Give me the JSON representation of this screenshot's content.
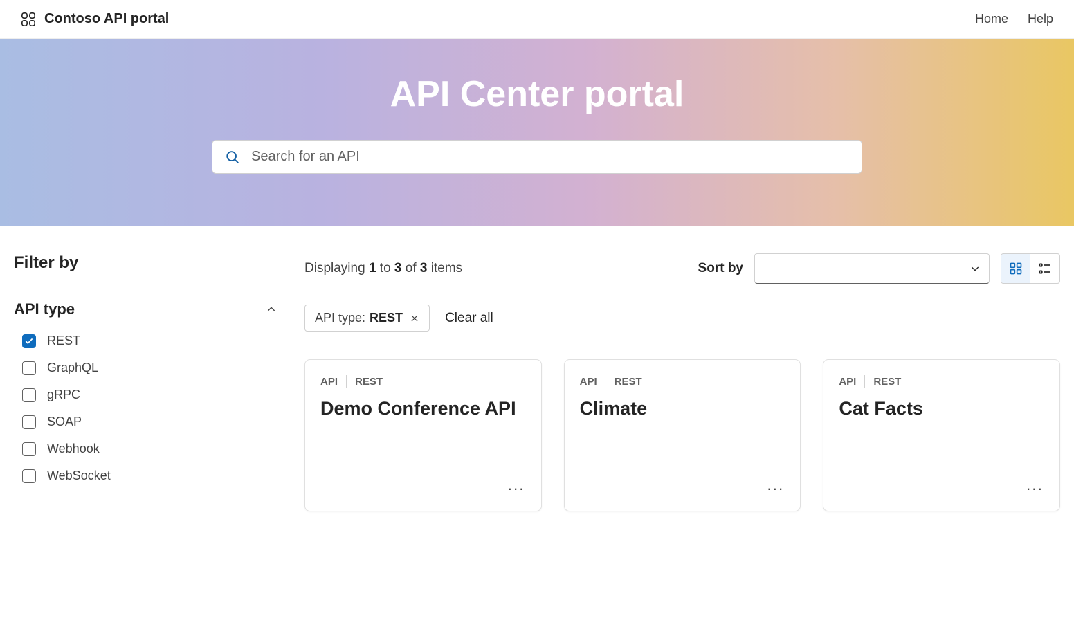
{
  "header": {
    "brand": "Contoso API portal",
    "nav": {
      "home": "Home",
      "help": "Help"
    }
  },
  "hero": {
    "title": "API Center portal",
    "search_placeholder": "Search for an API"
  },
  "sidebar": {
    "filter_heading": "Filter by",
    "groups": [
      {
        "title": "API type",
        "options": [
          {
            "label": "REST",
            "checked": true
          },
          {
            "label": "GraphQL",
            "checked": false
          },
          {
            "label": "gRPC",
            "checked": false
          },
          {
            "label": "SOAP",
            "checked": false
          },
          {
            "label": "Webhook",
            "checked": false
          },
          {
            "label": "WebSocket",
            "checked": false
          }
        ]
      }
    ]
  },
  "results": {
    "display_prefix": "Displaying ",
    "from": "1",
    "to_word": " to ",
    "to": "3",
    "of_word": " of ",
    "total": "3",
    "items_word": " items",
    "sort_label": "Sort by",
    "chip_type_label": "API type: ",
    "chip_type_value": "REST",
    "clear_all": "Clear all",
    "cards": [
      {
        "tag1": "API",
        "tag2": "REST",
        "title": "Demo Conference API"
      },
      {
        "tag1": "API",
        "tag2": "REST",
        "title": "Climate"
      },
      {
        "tag1": "API",
        "tag2": "REST",
        "title": "Cat Facts"
      }
    ]
  }
}
